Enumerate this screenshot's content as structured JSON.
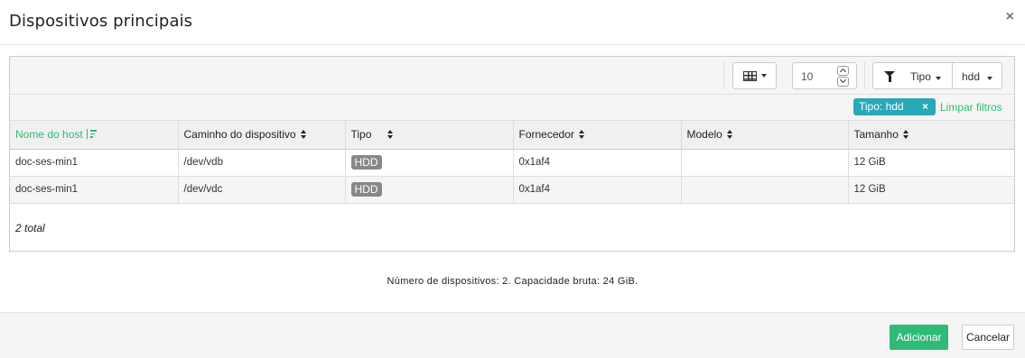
{
  "modal": {
    "title": "Dispositivos principais",
    "close_label": "×"
  },
  "toolbar": {
    "columns_icon": "grid-icon",
    "page_size": "10",
    "filter_icon": "funnel-icon",
    "filter_type": "Tipo",
    "filter_value": "hdd"
  },
  "active_filter": {
    "chip_label": "Tipo: hdd",
    "remove_label": "×",
    "clear_label": "Limpar filtros"
  },
  "table": {
    "columns": [
      {
        "label": "Nome do host",
        "sort": "asc"
      },
      {
        "label": "Caminho do dispositivo",
        "sort": "both"
      },
      {
        "label": "Tipo",
        "sort": "both"
      },
      {
        "label": "Fornecedor",
        "sort": "both"
      },
      {
        "label": "Modelo",
        "sort": "both"
      },
      {
        "label": "Tamanho",
        "sort": "both"
      }
    ],
    "rows": [
      {
        "host": "doc-ses-min1",
        "path": "/dev/vdb",
        "type": "HDD",
        "vendor": "0x1af4",
        "model": "",
        "size": "12 GiB"
      },
      {
        "host": "doc-ses-min1",
        "path": "/dev/vdc",
        "type": "HDD",
        "vendor": "0x1af4",
        "model": "",
        "size": "12 GiB"
      }
    ],
    "footer": "2 total"
  },
  "summary": "Número de dispositivos: 2. Capacidade bruta: 24 GiB.",
  "footer": {
    "add_label": "Adicionar",
    "cancel_label": "Cancelar"
  },
  "colors": {
    "accent": "#30ba78",
    "chip": "#2aa8b8"
  }
}
